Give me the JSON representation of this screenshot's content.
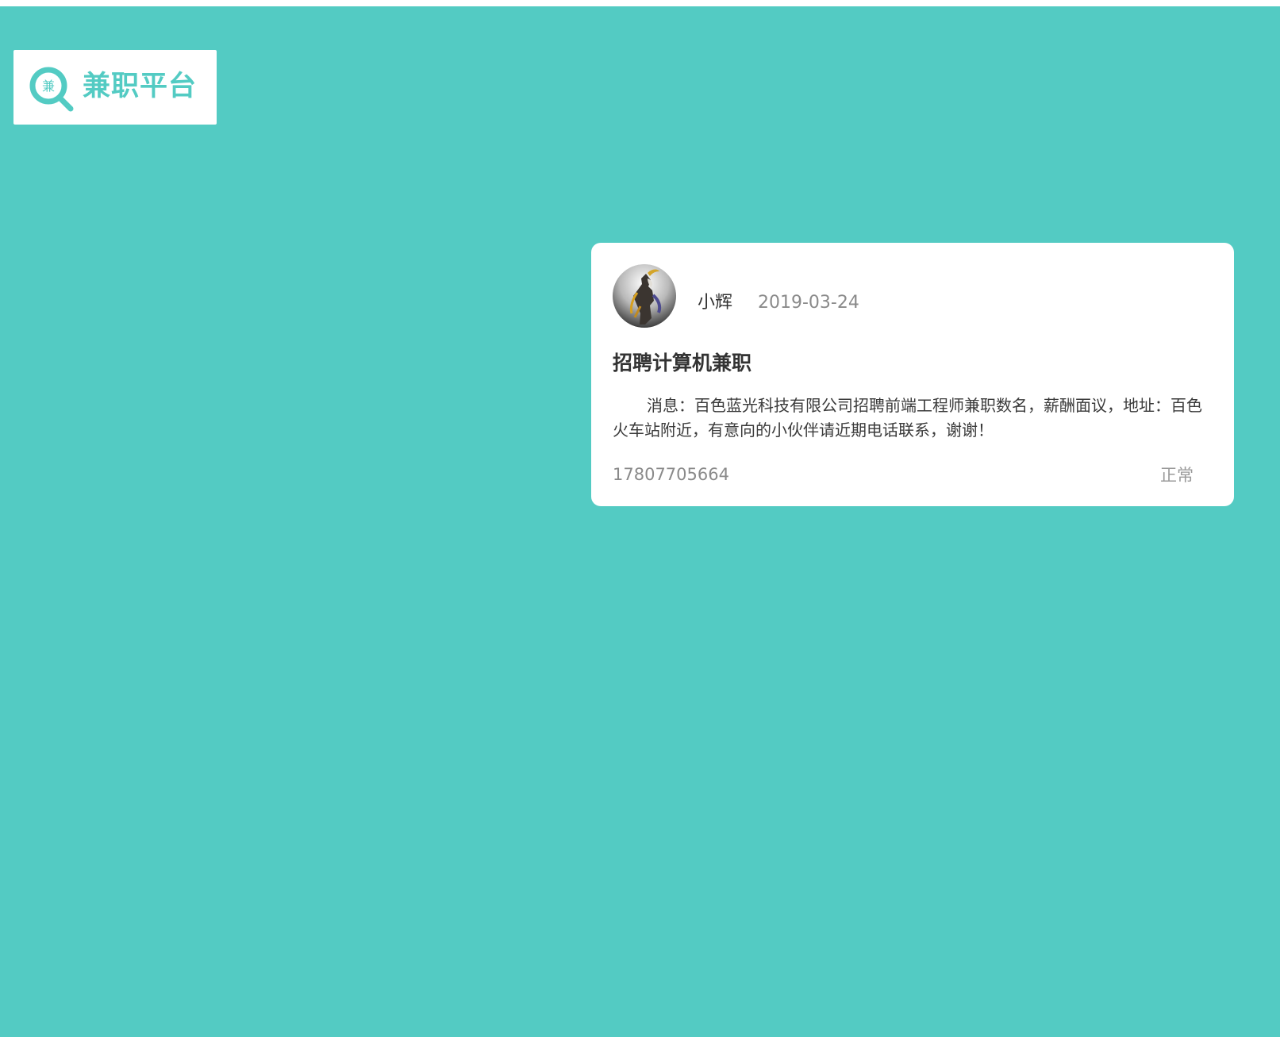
{
  "logo": {
    "title": "兼职平台",
    "icon_char": "兼",
    "icon": "search-magnifier-icon",
    "color": "#53cbc3"
  },
  "theme": {
    "background": "#53cbc3",
    "card_background": "#ffffff"
  },
  "post": {
    "author": "小辉",
    "date": "2019-03-24",
    "title": "招聘计算机兼职",
    "content": "消息：百色蓝光科技有限公司招聘前端工程师兼职数名，薪酬面议，地址：百色火车站附近，有意向的小伙伴请近期电话联系，谢谢！",
    "phone": "17807705664",
    "status": "正常"
  }
}
